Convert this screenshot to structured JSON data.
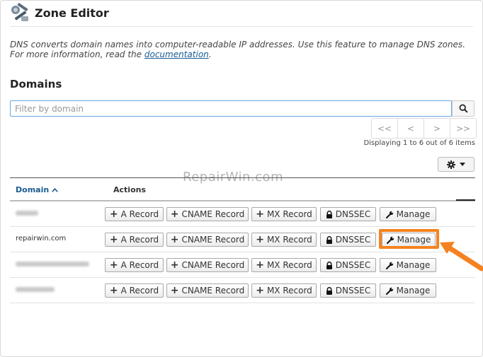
{
  "header": {
    "title": "Zone Editor",
    "logo_icon": "zone-editor-icon"
  },
  "description": {
    "text": "DNS converts domain names into computer-readable IP addresses. Use this feature to manage DNS zones. For more information, read the ",
    "link_text": "documentation",
    "suffix": "."
  },
  "domains": {
    "title": "Domains",
    "filter_placeholder": "Filter by domain",
    "pager": {
      "first": "<<",
      "prev": "<",
      "next": ">",
      "last": ">>"
    },
    "status": "Displaying 1 to 6 out of 6 items",
    "columns": {
      "domain": "Domain",
      "actions": "Actions"
    },
    "actions": {
      "a_record": "A Record",
      "cname_record": "CNAME Record",
      "mx_record": "MX Record",
      "dnssec": "DNSSEC",
      "manage": "Manage"
    },
    "rows": [
      {
        "domain": "",
        "blurred": true
      },
      {
        "domain": "repairwin.com",
        "blurred": false,
        "highlighted_action": "manage"
      },
      {
        "domain": "",
        "blurred": true
      },
      {
        "domain": "",
        "blurred": true
      }
    ]
  },
  "watermark": "RepairWin.com",
  "colors": {
    "link": "#1a5b92",
    "highlight": "#f58220",
    "filter_border": "#6aa8e0"
  }
}
